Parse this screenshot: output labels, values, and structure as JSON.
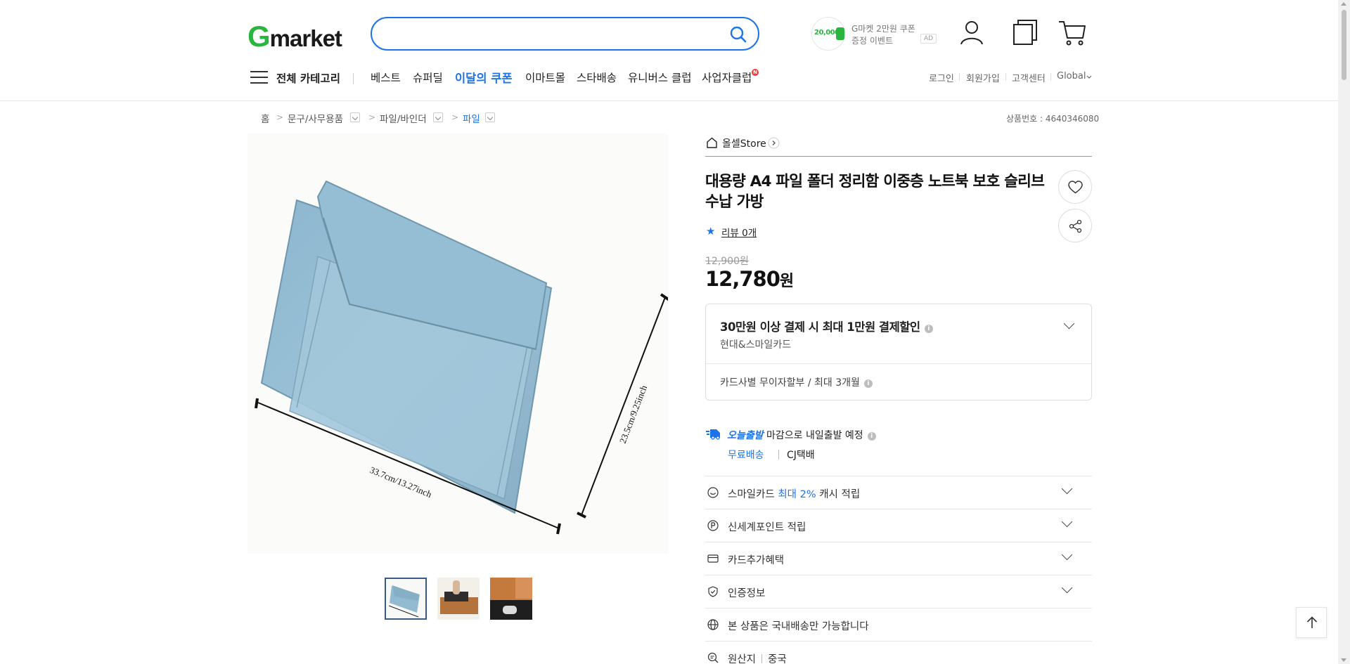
{
  "header": {
    "logo": {
      "g": "G",
      "rest": "market"
    },
    "search": {
      "value": "",
      "placeholder": ""
    },
    "gmarket_coupon": {
      "amount": "20,000",
      "line1": "G마켓 2만원 쿠폰",
      "line2": "증정 이벤트",
      "ad_label": "AD"
    },
    "icons": [
      "user-icon",
      "recent-items-icon",
      "cart-icon"
    ]
  },
  "gnb": {
    "all_category": "전체 카테고리",
    "items": [
      "베스트",
      "슈퍼딜",
      "이달의 쿠폰",
      "이마트몰",
      "스타배송",
      "유니버스 클럽",
      "사업자클럽"
    ],
    "new_badge": "N",
    "util": [
      "로그인",
      "회원가입",
      "고객센터",
      "Global"
    ]
  },
  "breadcrumb": {
    "items": [
      "홈",
      "문구/사무용품",
      "파일/바인더",
      "파일"
    ],
    "product_number": "상품번호 : 4640346080"
  },
  "gallery": {
    "image_labels": [
      "33.7cm/13.27inch",
      "23.5cm/9.25inch"
    ],
    "thumbnails": 3,
    "selected_index": 0
  },
  "product": {
    "store": "올셀Store",
    "title": "대용량 A4 파일 폴더 정리함 이중층 노트북 보호 슬리브 수납 가방",
    "review": "리뷰 0개",
    "original_price": "12,900원",
    "price": "12,780",
    "price_unit": "원"
  },
  "benefit": {
    "title": "30만원 이상 결제 시 최대 1만원 결제할인",
    "card": "현대&스마일카드",
    "installment": "카드사별 무이자할부 / 최대 3개월"
  },
  "shipping": {
    "badge": "오늘출발",
    "desc": "마감으로 내일출발 예정",
    "free": "무료배송",
    "carrier": "CJ택배"
  },
  "rows": {
    "smile_prefix": "스마일카드 ",
    "smile_highlight": "최대 2%",
    "smile_suffix": " 캐시 적립",
    "shinsegae": "신세계포인트 적립",
    "card_extra": "카드추가혜택",
    "certification": "인증정보",
    "domestic": "본 상품은 국내배송만 가능합니다",
    "origin_label": "원산지",
    "origin_value": "중국"
  },
  "colors": {
    "brand_green": "#2ab53e",
    "accent_blue": "#1e73e8",
    "product_blue": "#8fb6cc"
  }
}
